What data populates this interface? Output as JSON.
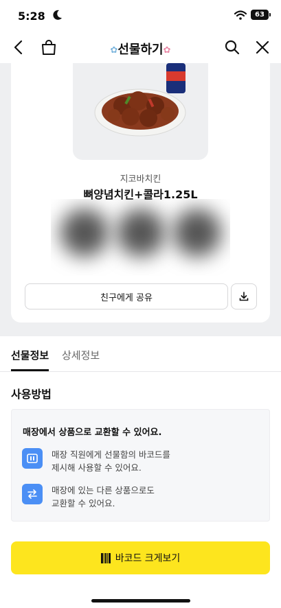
{
  "status_bar": {
    "time": "5:28",
    "battery": "63"
  },
  "header": {
    "title": "선물하기"
  },
  "gift": {
    "brand": "지코바치킨",
    "product": "뼈양념치킨+콜라1.25L",
    "share_label": "친구에게 공유"
  },
  "tabs": [
    {
      "label": "선물정보",
      "active": true
    },
    {
      "label": "상세정보",
      "active": false
    }
  ],
  "usage": {
    "title": "사용방법",
    "headline": "매장에서 상품으로 교환할 수 있어요.",
    "steps": [
      {
        "icon": "barcode-card-icon",
        "line1": "매장 직원에게 선물함의 바코드를",
        "line2": "제시해 사용할 수 있어요."
      },
      {
        "icon": "exchange-arrows-icon",
        "line1": "매장에 있는 다른 상품으로도",
        "line2": "교환할 수 있어요."
      }
    ]
  },
  "cta": {
    "label": "바코드 크게보기"
  },
  "colors": {
    "accent_yellow": "#fde51e",
    "icon_blue": "#4b8ff5"
  }
}
